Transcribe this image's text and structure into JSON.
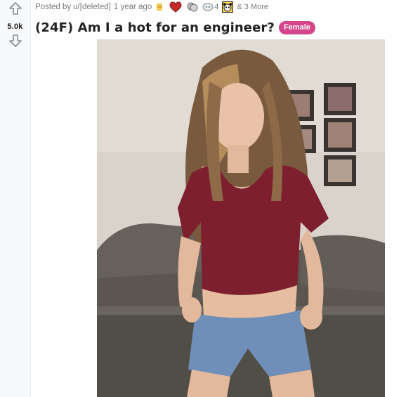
{
  "vote": {
    "up_icon": "arrow-up-icon",
    "down_icon": "arrow-down-icon",
    "count": "5.0k"
  },
  "post": {
    "meta": {
      "posted_by": "Posted by",
      "username": "u/[deleted]",
      "time": "1 year ago",
      "awards": [
        {
          "icon": "gold-award-icon",
          "color": "#f2c94c"
        },
        {
          "icon": "heart-award-icon",
          "color": "#d93a3a"
        },
        {
          "icon": "hugs-award-icon",
          "color": "#9aa0a6"
        },
        {
          "icon": "wholesome-award-icon",
          "color": "#8a9aa8",
          "count": "4"
        },
        {
          "icon": "panda-award-icon",
          "color": "#333333"
        }
      ],
      "more_awards": "& 3 More"
    },
    "title": "(24F) Am I a hot for an engineer?",
    "flair": {
      "label": "Female",
      "color": "#d4468a"
    }
  },
  "media": {
    "type": "photo",
    "colors": {
      "shirt": "#7d1f2e",
      "shorts": "#6f8fb8",
      "sofa": "#5b5750",
      "wall": "#d9d3cc"
    }
  }
}
